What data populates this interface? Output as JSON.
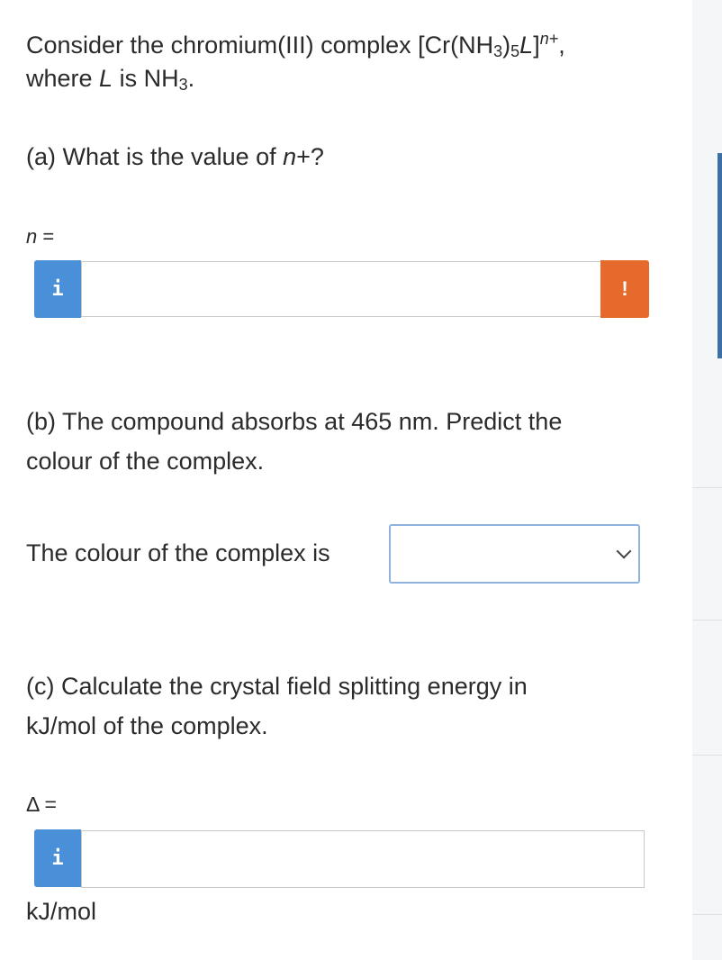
{
  "intro": {
    "line1_prefix": "Consider the chromium(III) complex [Cr(NH",
    "sub1": "3",
    "mid": ")",
    "sub2": "5",
    "L": "L",
    "bracket": "]",
    "sup": "n+",
    "comma": ",",
    "line2_prefix": "where ",
    "line2_L": "L",
    "line2_mid": " is NH",
    "line2_sub": "3",
    "line2_end": "."
  },
  "part_a": {
    "q_prefix": "(a) What is the value of ",
    "q_var": "n",
    "q_suffix": "+?",
    "label_var": "n",
    "label_eq": " =",
    "info_glyph": "i",
    "warn_glyph": "!",
    "input_value": ""
  },
  "part_b": {
    "q_line1": "(b) The compound absorbs at 465 nm. Predict the",
    "q_line2": "colour of the complex.",
    "prompt": "The colour of the complex is",
    "selected_value": ""
  },
  "part_c": {
    "q_line1": "(c) Calculate the crystal field splitting energy in",
    "q_line2": "kJ/mol of the complex.",
    "label": "Δ =",
    "info_glyph": "i",
    "input_value": "",
    "unit": "kJ/mol"
  }
}
